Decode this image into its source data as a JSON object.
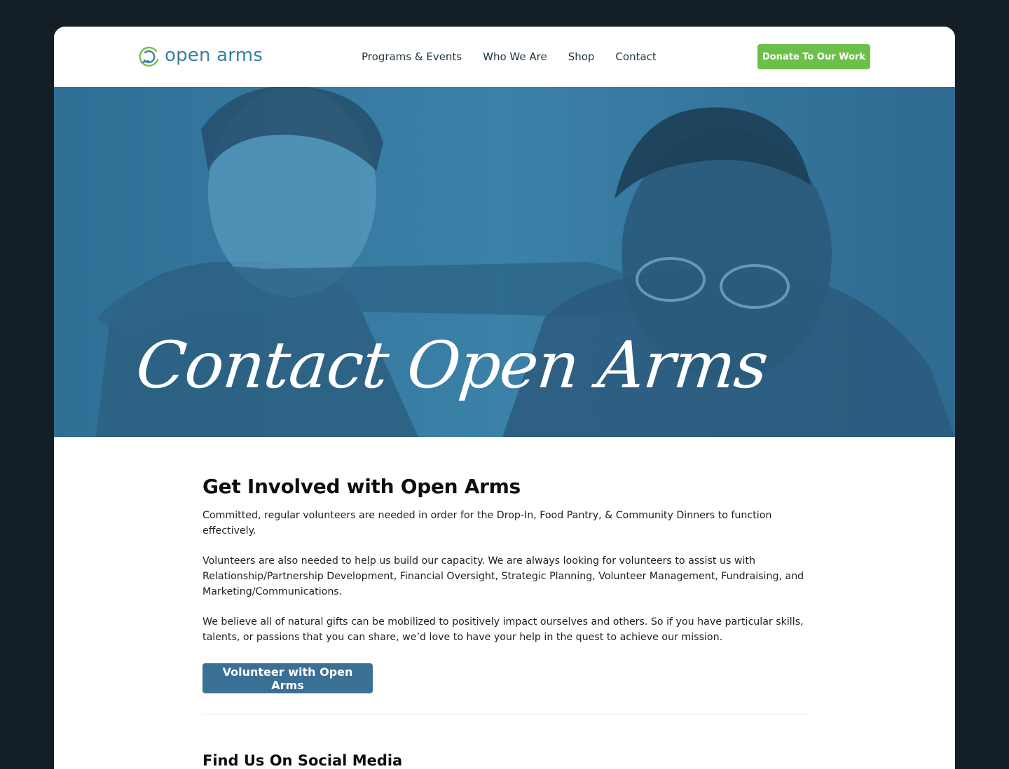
{
  "header": {
    "logo_text": "open arms",
    "nav": [
      "Programs & Events",
      "Who We Are",
      "Shop",
      "Contact"
    ],
    "donate_label": "Donate To Our Work"
  },
  "hero": {
    "title": "Contact Open Arms"
  },
  "main": {
    "heading": "Get Involved with Open Arms",
    "paragraphs": [
      "Committed, regular volunteers are needed in order for the Drop-In, Food Pantry, & Community Dinners to function effectively.",
      "Volunteers are also needed to help us build our capacity. We are always looking for volunteers to assist us with Relationship/Partnership Development, Financial Oversight, Strategic Planning, Volunteer Management, Fundraising, and Marketing/Communications.",
      "We believe all of natural gifts can be mobilized to positively impact ourselves and others. So if you have particular skills, talents, or passions that you can share, we’d love to have your help in the quest to achieve our mission."
    ],
    "volunteer_button": "Volunteer with Open Arms",
    "social_heading": "Find Us On Social Media"
  },
  "colors": {
    "page_bg": "#141e27",
    "brand_blue": "#3a7ea0",
    "hero_tint": "#3a7da3",
    "donate_green": "#6cc04a",
    "button_blue": "#3b7095"
  },
  "icons": [
    "open-arms-logo-icon"
  ]
}
